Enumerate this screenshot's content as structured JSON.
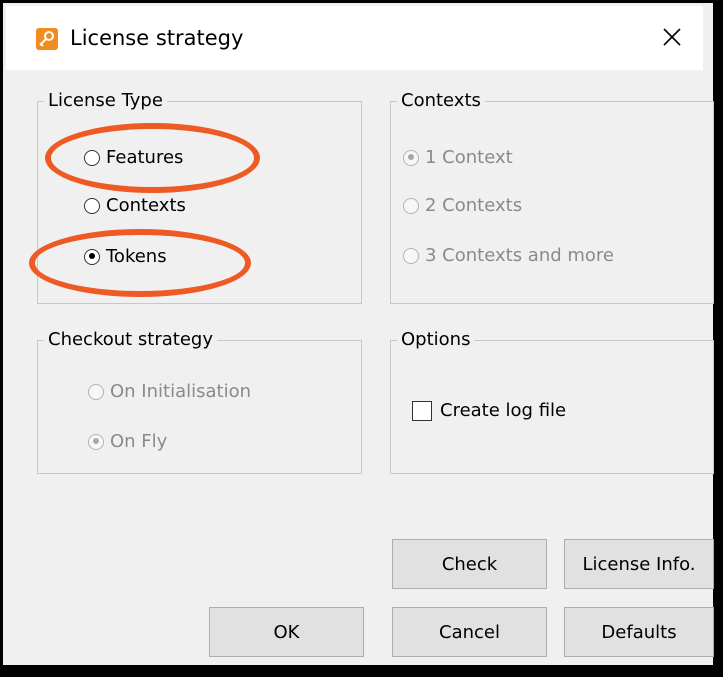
{
  "window": {
    "title": "License strategy",
    "title_icon": "key-icon",
    "close_icon": "close-icon"
  },
  "license_type": {
    "label": "License Type",
    "options": [
      {
        "label": "Features",
        "checked": false,
        "enabled": true
      },
      {
        "label": "Contexts",
        "checked": false,
        "enabled": true
      },
      {
        "label": "Tokens",
        "checked": true,
        "enabled": true
      }
    ]
  },
  "contexts": {
    "label": "Contexts",
    "options": [
      {
        "label": "1 Context",
        "checked": true,
        "enabled": false
      },
      {
        "label": "2 Contexts",
        "checked": false,
        "enabled": false
      },
      {
        "label": "3 Contexts and more",
        "checked": false,
        "enabled": false
      }
    ]
  },
  "checkout_strategy": {
    "label": "Checkout strategy",
    "options": [
      {
        "label": "On Initialisation",
        "checked": false,
        "enabled": false
      },
      {
        "label": "On Fly",
        "checked": true,
        "enabled": false
      }
    ]
  },
  "options": {
    "label": "Options",
    "create_log_file": {
      "label": "Create log file",
      "checked": false
    }
  },
  "buttons": {
    "check": "Check",
    "license_info": "License Info.",
    "ok": "OK",
    "cancel": "Cancel",
    "defaults": "Defaults"
  },
  "colors": {
    "annotation": "#ee5a24",
    "dialog_bg": "#f0f0f0",
    "disabled_text": "#8a8a8a",
    "title_icon": "#f28c1e"
  }
}
